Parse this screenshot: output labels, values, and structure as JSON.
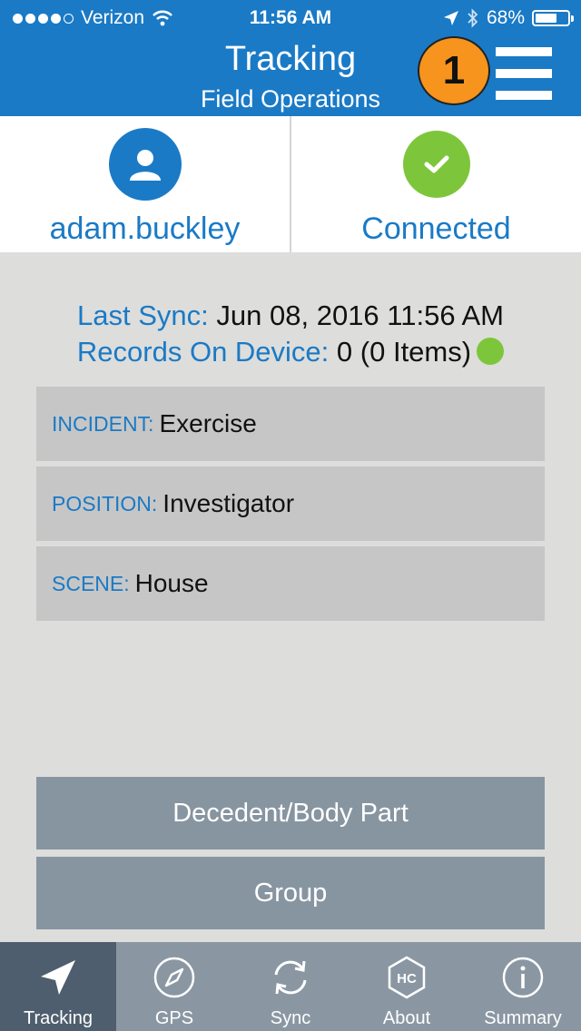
{
  "status_bar": {
    "carrier": "Verizon",
    "time": "11:56 AM",
    "battery": "68%",
    "battery_level": 0.68
  },
  "header": {
    "title": "Tracking",
    "subtitle": "Field Operations",
    "badge": "1",
    "menu_icon": "hamburger-menu-icon"
  },
  "user_card": {
    "icon": "user-icon",
    "label": "adam.buckley"
  },
  "connection_card": {
    "icon": "checkmark-icon",
    "label": "Connected"
  },
  "sync": {
    "last_sync_label": "Last Sync:",
    "last_sync_value": "Jun 08, 2016 11:56 AM",
    "records_label": "Records On Device:",
    "records_value": "0 (0 Items)"
  },
  "fields": [
    {
      "label": "INCIDENT:",
      "value": "Exercise"
    },
    {
      "label": "POSITION:",
      "value": "Investigator"
    },
    {
      "label": "SCENE:",
      "value": "House"
    }
  ],
  "buttons": {
    "decedent": "Decedent/Body Part",
    "group": "Group"
  },
  "tabs": [
    {
      "label": "Tracking",
      "icon": "navigation-arrow-icon",
      "active": true
    },
    {
      "label": "GPS",
      "icon": "compass-icon",
      "active": false
    },
    {
      "label": "Sync",
      "icon": "sync-icon",
      "active": false
    },
    {
      "label": "About",
      "icon": "hc-logo-icon",
      "active": false
    },
    {
      "label": "Summary",
      "icon": "info-icon",
      "active": false
    }
  ],
  "colors": {
    "header": "#1a7ac6",
    "accent_text": "#1a7ac6",
    "badge": "#f7941d",
    "connected": "#7dc63b",
    "tab_bar": "#8a97a3",
    "tab_active": "#4e5e6e",
    "button": "#8795a1"
  }
}
